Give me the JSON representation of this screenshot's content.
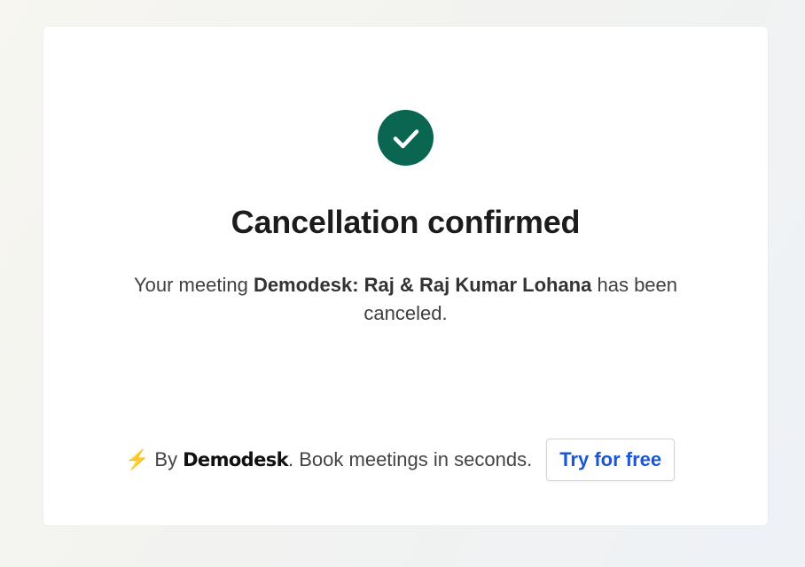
{
  "status_icon": "check-circle-icon",
  "colors": {
    "success": "#0b6651",
    "link": "#1a56d6",
    "bolt": "#f1b21b"
  },
  "title": "Cancellation confirmed",
  "message": {
    "prefix": "Your meeting ",
    "meeting_name": "Demodesk: Raj & Raj Kumar Lohana",
    "suffix": " has been canceled."
  },
  "footer": {
    "bolt_icon": "⚡",
    "by_text": "By",
    "brand": "Demodesk",
    "tagline": ". Book meetings in seconds.",
    "cta_label": "Try for free"
  }
}
